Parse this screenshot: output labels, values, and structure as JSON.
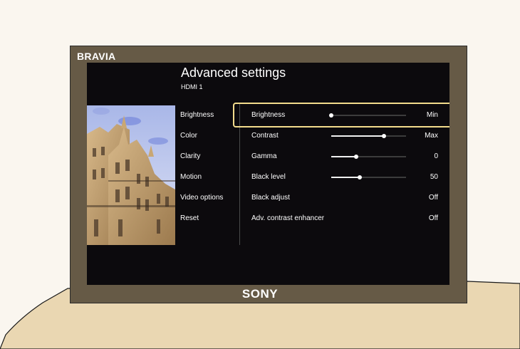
{
  "tv": {
    "brand_top": "BRAVIA",
    "brand_bottom": "SONY"
  },
  "settings": {
    "title": "Advanced settings",
    "input_source": "HDMI 1"
  },
  "left_menu": [
    {
      "label": "Brightness"
    },
    {
      "label": "Color"
    },
    {
      "label": "Clarity"
    },
    {
      "label": "Motion"
    },
    {
      "label": "Video options"
    },
    {
      "label": "Reset"
    }
  ],
  "rows": [
    {
      "label": "Brightness",
      "value": "Min",
      "slider_level": 0.0,
      "focused": true
    },
    {
      "label": "Contrast",
      "value": "Max",
      "slider_level": 0.7
    },
    {
      "label": "Gamma",
      "value": "0",
      "slider_level": 0.33
    },
    {
      "label": "Black level",
      "value": "50",
      "slider_level": 0.38
    },
    {
      "label": "Black adjust",
      "value": "Off"
    },
    {
      "label": "Adv. contrast enhancer",
      "value": "Off"
    }
  ],
  "colors": {
    "bezel": "#665a46",
    "screen": "#0c0a0d",
    "focus_outline": "#f3dc8c",
    "table": "#ead7b2",
    "wall": "#faf6ef"
  }
}
